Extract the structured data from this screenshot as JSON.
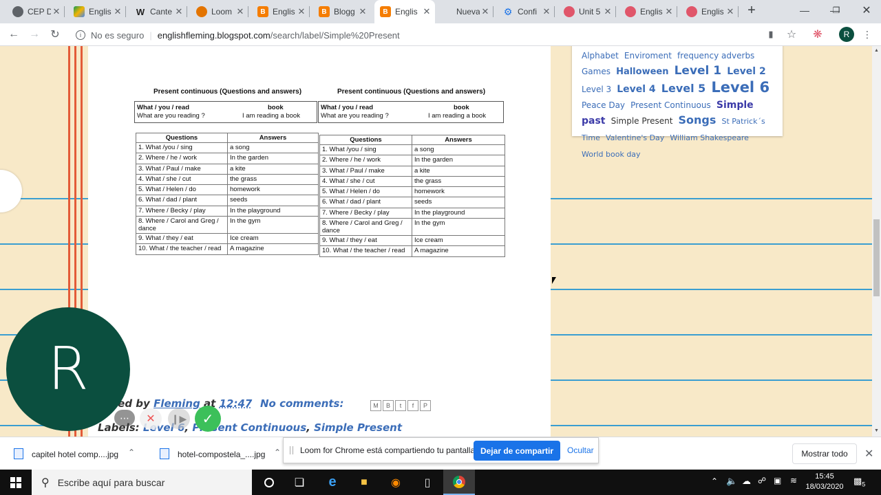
{
  "browser": {
    "tabs": [
      {
        "title": "CEP D",
        "color": "#5f6368",
        "icon": "chrome-icon"
      },
      {
        "title": "Englis",
        "color": "#1a73e8",
        "icon": "drive-icon"
      },
      {
        "title": "Cante",
        "color": "#222222",
        "icon": "wikipedia-icon"
      },
      {
        "title": "Loom",
        "color": "#e37400",
        "icon": "loom-icon"
      },
      {
        "title": "Englis",
        "color": "#f57d00",
        "icon": "blogger-icon"
      },
      {
        "title": "Blogg",
        "color": "#f57d00",
        "icon": "blogger-icon"
      },
      {
        "title": "Englis",
        "color": "#f57d00",
        "icon": "blogger-icon"
      },
      {
        "title": "Nueva pe",
        "color": "#ffffff",
        "icon": "none"
      },
      {
        "title": "Confi",
        "color": "#1a73e8",
        "icon": "gear-icon"
      },
      {
        "title": "Unit 5",
        "color": "#e0566a",
        "icon": "spiral-icon"
      },
      {
        "title": "Englis",
        "color": "#e0566a",
        "icon": "spiral-icon"
      },
      {
        "title": "Englis",
        "color": "#e0566a",
        "icon": "spiral-icon"
      }
    ],
    "security_label": "No es seguro",
    "url_domain": "englishfleming.blogspot.com",
    "url_path": "/search/label/Simple%20Present",
    "profile_initial": "R"
  },
  "sidebar_tags": [
    {
      "text": "Alphabet",
      "size": 12,
      "color": "#3b6db8"
    },
    {
      "text": "Enviroment",
      "size": 12,
      "color": "#3b6db8"
    },
    {
      "text": "frequency adverbs",
      "size": 12,
      "color": "#3b6db8"
    },
    {
      "text": "Games",
      "size": 12,
      "color": "#3b6db8"
    },
    {
      "text": "Halloween",
      "size": 13,
      "color": "#3b6db8"
    },
    {
      "text": "Level 1",
      "size": 17,
      "color": "#3b6db8"
    },
    {
      "text": "Level 2",
      "size": 14,
      "color": "#3b6db8"
    },
    {
      "text": "Level 3",
      "size": 12,
      "color": "#3b6db8"
    },
    {
      "text": "Level 4",
      "size": 14,
      "color": "#3b6db8"
    },
    {
      "text": "Level 5",
      "size": 16,
      "color": "#3b6db8"
    },
    {
      "text": "Level 6",
      "size": 21,
      "color": "#3b6db8"
    },
    {
      "text": "Peace Day",
      "size": 12,
      "color": "#3b6db8"
    },
    {
      "text": "Present Continuous",
      "size": 12,
      "color": "#3b6db8"
    },
    {
      "text": "Simple past",
      "size": 14,
      "color": "#3b3aa8"
    },
    {
      "text": "Simple Present",
      "size": 12,
      "color": "#333333"
    },
    {
      "text": "Songs",
      "size": 16,
      "color": "#3b6db8"
    },
    {
      "text": "St Patrick´s Time",
      "size": 11,
      "color": "#3b6db8"
    },
    {
      "text": "Valentine's Day",
      "size": 11,
      "color": "#3b6db8"
    },
    {
      "text": "William Shakespeare",
      "size": 11,
      "color": "#3b6db8"
    },
    {
      "text": "World book day",
      "size": 11,
      "color": "#3b6db8"
    }
  ],
  "worksheet": {
    "title": "Present continuous (Questions and answers)",
    "example_q": "What / you / read",
    "example_a_word": "book",
    "example_q2": "What are you reading ?",
    "example_a2": "I am  reading a book",
    "col_q": "Questions",
    "col_a": "Answers",
    "rows": [
      {
        "q": "1. What /you / sing",
        "a": "a song"
      },
      {
        "q": "2. Where / he / work",
        "a": "In the garden"
      },
      {
        "q": "3. What / Paul / make",
        "a": "a kite"
      },
      {
        "q": "4. What / she / cut",
        "a": "the grass"
      },
      {
        "q": "5. What / Helen / do",
        "a": "homework"
      },
      {
        "q": "6. What / dad / plant",
        "a": "seeds"
      },
      {
        "q": "7. Where / Becky / play",
        "a": "In the playground"
      },
      {
        "q": "8. Where / Carol and Greg / dance",
        "a": "In the gym"
      },
      {
        "q": "9. What / they / eat",
        "a": "Ice cream"
      },
      {
        "q": "10. What / the teacher / read",
        "a": "A magazine"
      }
    ]
  },
  "post_footer": {
    "posted_by": "ted by",
    "author": "Fleming",
    "at": "at",
    "time": "12:47",
    "comments": "No comments:",
    "labels_prefix": "Labels:",
    "label1": "Level 6",
    "label2": "Present Continuous",
    "label3": "Simple Present"
  },
  "loom": {
    "avatar_initial": "R",
    "banner_text": "Loom for Chrome está compartiendo tu pantalla.",
    "stop_button": "Dejar de compartir",
    "hide_link": "Ocultar"
  },
  "downloads": {
    "file1": "capitel hotel comp....jpg",
    "file2": "hotel-compostela_....jpg",
    "show_all": "Mostrar todo"
  },
  "taskbar": {
    "search_placeholder": "Escribe aquí para buscar",
    "time": "15:45",
    "date": "18/03/2020",
    "notification_count": "5"
  }
}
